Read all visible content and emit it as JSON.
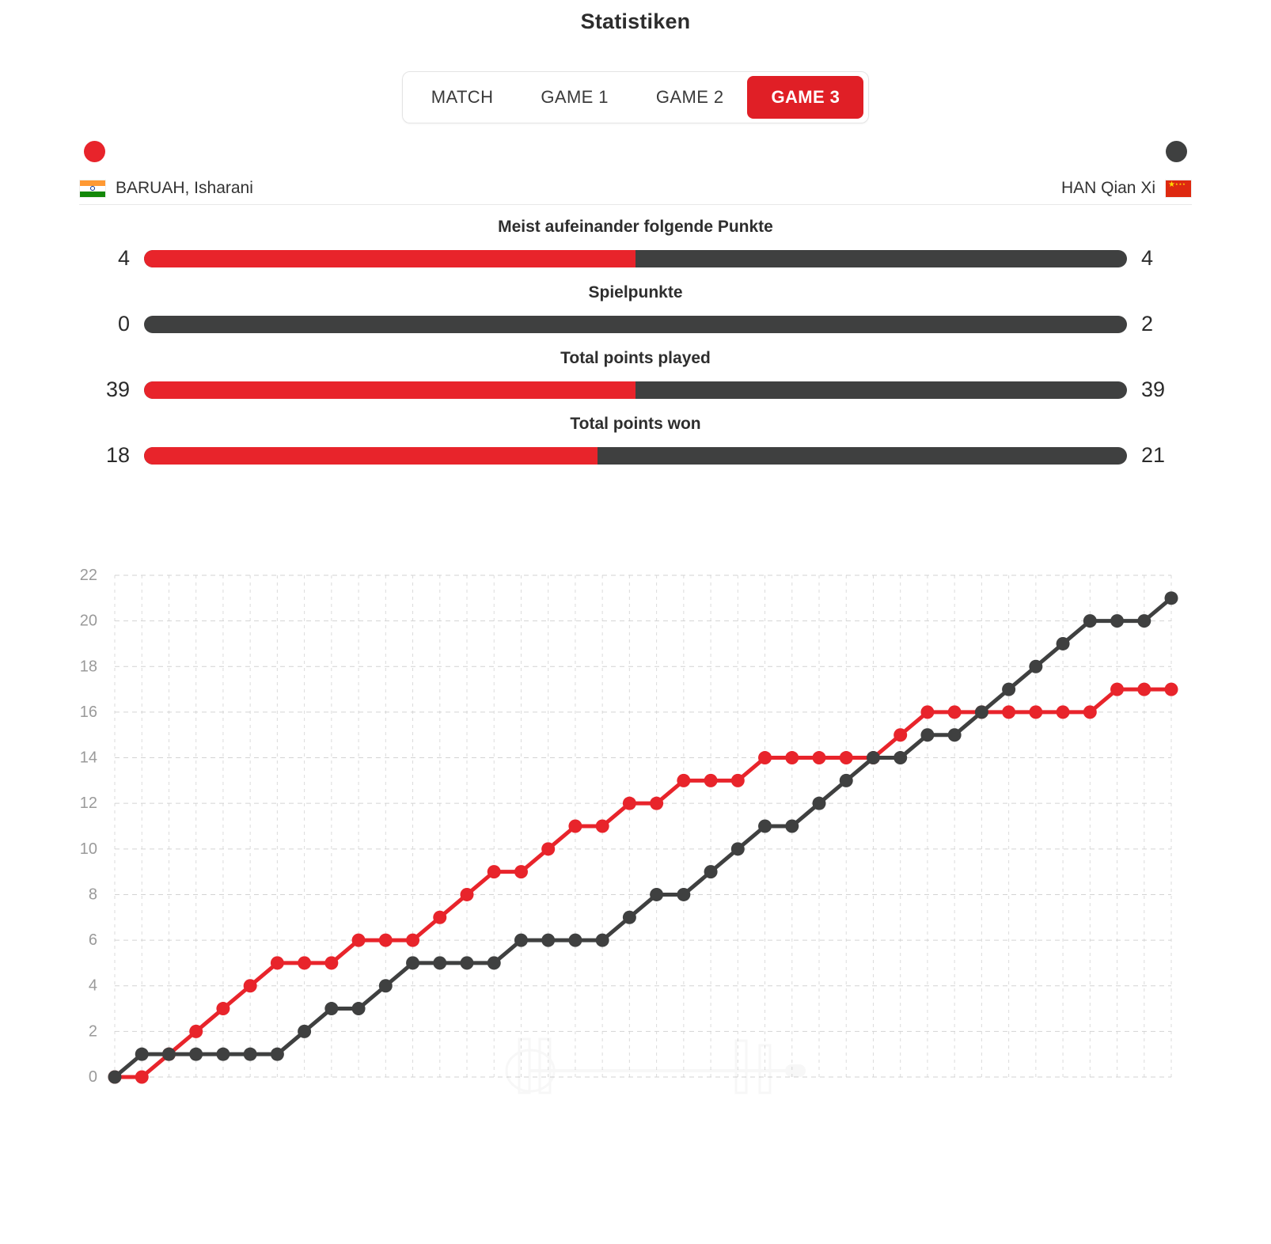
{
  "header": {
    "title": "Statistiken"
  },
  "tabs": {
    "items": [
      {
        "label": "MATCH",
        "active": false
      },
      {
        "label": "GAME 1",
        "active": false
      },
      {
        "label": "GAME 2",
        "active": false
      },
      {
        "label": "GAME 3",
        "active": true
      }
    ]
  },
  "players": {
    "left": {
      "name": "BARUAH, Isharani",
      "flag": "flag-india",
      "color": "#e8242b",
      "marker": "red-dot"
    },
    "right": {
      "name": "HAN Qian Xi",
      "flag": "flag-china",
      "color": "#3f4040",
      "marker": "dark-dot"
    }
  },
  "stats": [
    {
      "label": "Meist aufeinander folgende Punkte",
      "left": "4",
      "right": "4",
      "left_pct": 50
    },
    {
      "label": "Spielpunkte",
      "left": "0",
      "right": "2",
      "left_pct": 0
    },
    {
      "label": "Total points played",
      "left": "39",
      "right": "39",
      "left_pct": 50
    },
    {
      "label": "Total points won",
      "left": "18",
      "right": "21",
      "left_pct": 46.15
    }
  ],
  "colors": {
    "accent_red": "#e01f26",
    "series_red": "#e8242b",
    "series_dark": "#3f4040",
    "grid": "#cfcfcf",
    "axis_text": "#9a9a9a"
  },
  "chart_data": {
    "type": "line",
    "title": "",
    "xlabel": "",
    "ylabel": "",
    "xlim": [
      0,
      39
    ],
    "ylim": [
      0,
      22
    ],
    "grid": true,
    "legend_position": "none",
    "y_ticks": [
      0,
      2,
      4,
      6,
      8,
      10,
      12,
      14,
      16,
      18,
      20,
      22
    ],
    "x": [
      0,
      1,
      2,
      3,
      4,
      5,
      6,
      7,
      8,
      9,
      10,
      11,
      12,
      13,
      14,
      15,
      16,
      17,
      18,
      19,
      20,
      21,
      22,
      23,
      24,
      25,
      26,
      27,
      28,
      29,
      30,
      31,
      32,
      33,
      34,
      35,
      36,
      37,
      38,
      39
    ],
    "series": [
      {
        "name": "BARUAH, Isharani",
        "color": "#e8242b",
        "values": [
          0,
          0,
          1,
          2,
          3,
          4,
          5,
          5,
          5,
          6,
          6,
          6,
          7,
          8,
          9,
          9,
          10,
          11,
          11,
          12,
          12,
          13,
          13,
          13,
          14,
          14,
          14,
          14,
          14,
          15,
          16,
          16,
          16,
          16,
          16,
          16,
          16,
          17,
          17,
          17
        ]
      },
      {
        "name": "HAN Qian Xi",
        "color": "#3f4040",
        "values": [
          0,
          1,
          1,
          1,
          1,
          1,
          1,
          2,
          3,
          3,
          4,
          5,
          5,
          5,
          5,
          6,
          6,
          6,
          6,
          7,
          8,
          8,
          9,
          10,
          11,
          11,
          12,
          13,
          14,
          14,
          15,
          15,
          16,
          17,
          18,
          19,
          20,
          20,
          20,
          21
        ]
      }
    ]
  }
}
